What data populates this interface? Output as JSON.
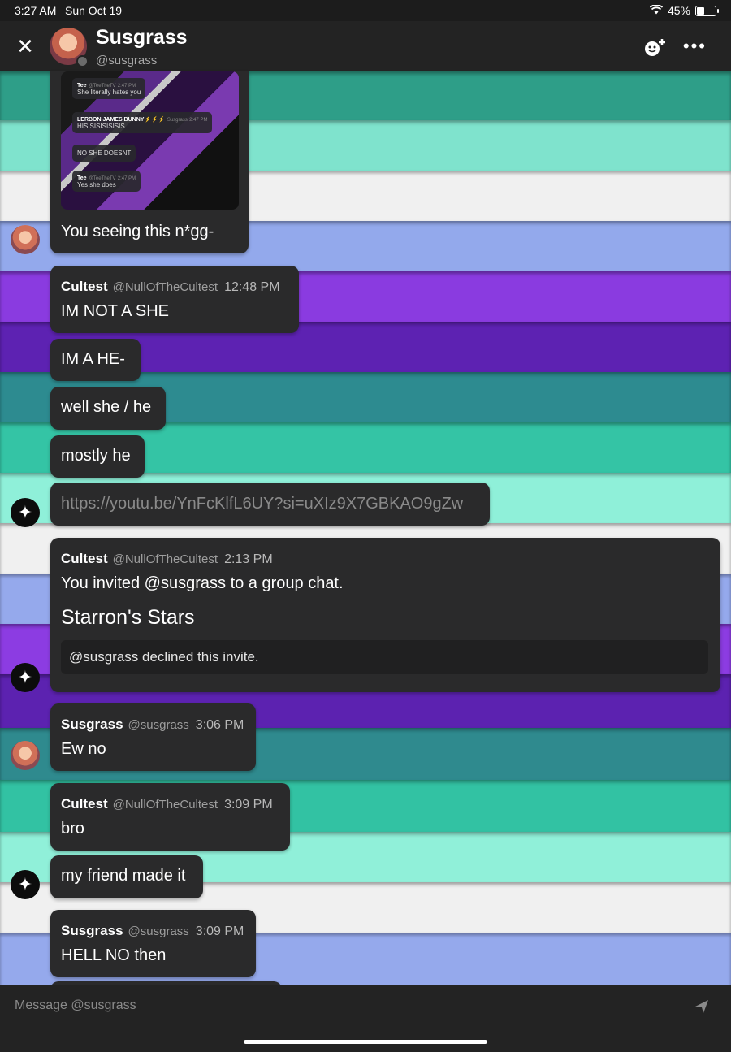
{
  "status_bar": {
    "time": "3:27 AM",
    "date": "Sun Oct 19",
    "battery": "45%"
  },
  "header": {
    "name": "Susgrass",
    "handle": "@susgrass"
  },
  "screenshot_attachment": {
    "msg1_author": "Tee",
    "msg1_handle": "@TeeTheTV",
    "msg1_time": "2:47 PM",
    "msg1_text": "She literally hates you",
    "msg2_author": "LERBON JAMES BUNNY⚡⚡⚡",
    "msg2_handle": "Susgrass",
    "msg2_time": "2:47 PM",
    "msg2_text": "HISISISISISISIS",
    "msg3_text": "NO SHE DOESNT",
    "msg4_author": "Tee",
    "msg4_handle": "@TeeTheTV",
    "msg4_time": "2:47 PM",
    "msg4_text": "Yes she does"
  },
  "messages": {
    "m1_text": "You seeing this n*gg-",
    "m2_author": "Cultest",
    "m2_handle": "@NullOfTheCultest",
    "m2_time": "12:48 PM",
    "m2_text": "IM NOT A SHE",
    "m3_text": "IM A HE-",
    "m4_text": "well she / he",
    "m5_text": "mostly he",
    "m6_link": "https://youtu.be/YnFcKlfL6UY?si=uXIz9X7GBKAO9gZw",
    "m7_author": "Cultest",
    "m7_handle": "@NullOfTheCultest",
    "m7_time": "2:13 PM",
    "m7_text": "You invited @susgrass to a group chat.",
    "m7_group": "Starron's Stars",
    "m7_status": "@susgrass declined this invite.",
    "m8_author": "Susgrass",
    "m8_handle": "@susgrass",
    "m8_time": "3:06 PM",
    "m8_text": "Ew no",
    "m9_author": "Cultest",
    "m9_handle": "@NullOfTheCultest",
    "m9_time": "3:09 PM",
    "m9_text": "bro",
    "m10_text": "my friend made it",
    "m11_author": "Susgrass",
    "m11_handle": "@susgrass",
    "m11_time": "3:09 PM",
    "m11_text": "HELL NO then"
  },
  "composer": {
    "placeholder": "Message @susgrass"
  },
  "icons": {
    "close": "close-icon",
    "add_friend": "add-friend-icon",
    "more": "more-icon",
    "send": "send-icon",
    "wifi": "wifi-icon",
    "battery": "battery-icon"
  },
  "colors": {
    "bubble": "#2a2a2b",
    "header": "#232323",
    "stripes": [
      "#2fa88f",
      "#7ce6cf",
      "#eeeeee",
      "#8fa8ee",
      "#7b2fd0",
      "#5a1fb0",
      "#2a8a8e",
      "#33c3a4"
    ]
  }
}
